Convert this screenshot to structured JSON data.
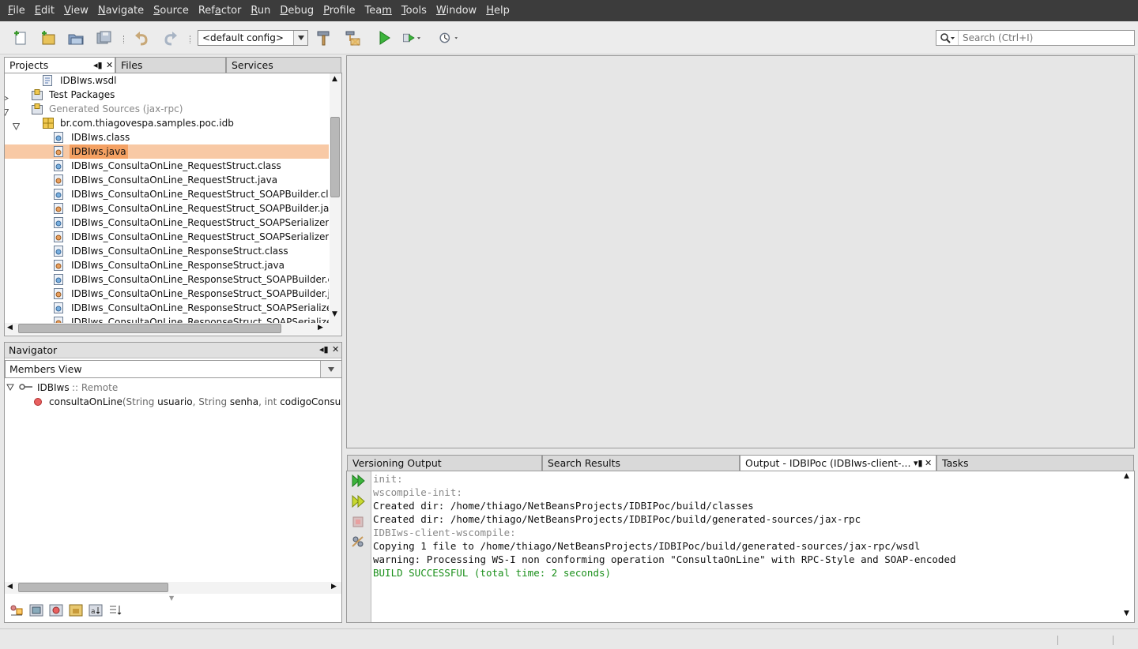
{
  "menu": {
    "items": [
      {
        "pre": "",
        "u": "F",
        "post": "ile"
      },
      {
        "pre": "",
        "u": "E",
        "post": "dit"
      },
      {
        "pre": "",
        "u": "V",
        "post": "iew"
      },
      {
        "pre": "",
        "u": "N",
        "post": "avigate"
      },
      {
        "pre": "",
        "u": "S",
        "post": "ource"
      },
      {
        "pre": "Ref",
        "u": "a",
        "post": "ctor"
      },
      {
        "pre": "",
        "u": "R",
        "post": "un"
      },
      {
        "pre": "",
        "u": "D",
        "post": "ebug"
      },
      {
        "pre": "",
        "u": "P",
        "post": "rofile"
      },
      {
        "pre": "Tea",
        "u": "m",
        "post": ""
      },
      {
        "pre": "",
        "u": "T",
        "post": "ools"
      },
      {
        "pre": "",
        "u": "W",
        "post": "indow"
      },
      {
        "pre": "",
        "u": "H",
        "post": "elp"
      }
    ]
  },
  "toolbar": {
    "config_value": "<default config>",
    "search_placeholder": "Search (Ctrl+I)",
    "icons": [
      "new-file-icon",
      "new-project-icon",
      "open-project-icon",
      "save-all-icon",
      "undo-icon",
      "redo-icon",
      "build-hammer-icon",
      "clean-build-icon",
      "run-icon",
      "debug-icon",
      "profile-icon"
    ]
  },
  "projects_panel": {
    "tabs": [
      "Projects",
      "Files",
      "Services"
    ],
    "tree": [
      {
        "label": "IDBIws.wsdl",
        "indent": 2,
        "toggle": "",
        "icon": "wsdl-file-icon",
        "grey": false,
        "selected": false
      },
      {
        "label": "Test Packages",
        "indent": 1,
        "toggle": "collapsed",
        "icon": "package-folder-icon",
        "grey": false,
        "selected": false
      },
      {
        "label": "Generated Sources (jax-rpc)",
        "indent": 1,
        "toggle": "expanded",
        "icon": "package-folder-icon",
        "grey": true,
        "selected": false
      },
      {
        "label": "br.com.thiagovespa.samples.poc.idb",
        "indent": 2,
        "toggle": "expanded",
        "icon": "package-icon",
        "grey": false,
        "selected": false
      },
      {
        "label": "IDBIws.class",
        "indent": 3,
        "toggle": "",
        "icon": "class-file-icon",
        "grey": false,
        "selected": false
      },
      {
        "label": "IDBIws.java",
        "indent": 3,
        "toggle": "",
        "icon": "java-file-icon",
        "grey": false,
        "selected": true
      },
      {
        "label": "IDBIws_ConsultaOnLine_RequestStruct.class",
        "indent": 3,
        "toggle": "",
        "icon": "class-file-icon",
        "grey": false,
        "selected": false
      },
      {
        "label": "IDBIws_ConsultaOnLine_RequestStruct.java",
        "indent": 3,
        "toggle": "",
        "icon": "java-file-icon",
        "grey": false,
        "selected": false
      },
      {
        "label": "IDBIws_ConsultaOnLine_RequestStruct_SOAPBuilder.class",
        "indent": 3,
        "toggle": "",
        "icon": "class-file-icon",
        "grey": false,
        "selected": false
      },
      {
        "label": "IDBIws_ConsultaOnLine_RequestStruct_SOAPBuilder.java",
        "indent": 3,
        "toggle": "",
        "icon": "java-file-icon",
        "grey": false,
        "selected": false
      },
      {
        "label": "IDBIws_ConsultaOnLine_RequestStruct_SOAPSerializer.class",
        "indent": 3,
        "toggle": "",
        "icon": "class-file-icon",
        "grey": false,
        "selected": false
      },
      {
        "label": "IDBIws_ConsultaOnLine_RequestStruct_SOAPSerializer.java",
        "indent": 3,
        "toggle": "",
        "icon": "java-file-icon",
        "grey": false,
        "selected": false
      },
      {
        "label": "IDBIws_ConsultaOnLine_ResponseStruct.class",
        "indent": 3,
        "toggle": "",
        "icon": "class-file-icon",
        "grey": false,
        "selected": false
      },
      {
        "label": "IDBIws_ConsultaOnLine_ResponseStruct.java",
        "indent": 3,
        "toggle": "",
        "icon": "java-file-icon",
        "grey": false,
        "selected": false
      },
      {
        "label": "IDBIws_ConsultaOnLine_ResponseStruct_SOAPBuilder.class",
        "indent": 3,
        "toggle": "",
        "icon": "class-file-icon",
        "grey": false,
        "selected": false
      },
      {
        "label": "IDBIws_ConsultaOnLine_ResponseStruct_SOAPBuilder.java",
        "indent": 3,
        "toggle": "",
        "icon": "java-file-icon",
        "grey": false,
        "selected": false
      },
      {
        "label": "IDBIws_ConsultaOnLine_ResponseStruct_SOAPSerializer.class",
        "indent": 3,
        "toggle": "",
        "icon": "class-file-icon",
        "grey": false,
        "selected": false
      },
      {
        "label": "IDBIws_ConsultaOnLine_ResponseStruct_SOAPSerializer.java",
        "indent": 3,
        "toggle": "",
        "icon": "java-file-icon",
        "grey": false,
        "selected": false
      }
    ]
  },
  "navigator": {
    "title": "Navigator",
    "view": "Members View",
    "root_name": "IDBIws",
    "root_kind": " :: Remote",
    "method_name": "consultaOnLine",
    "method_sig": [
      {
        "t": "(",
        "grey": true
      },
      {
        "t": "String",
        "grey": true
      },
      {
        "t": " usuario",
        "grey": false
      },
      {
        "t": ", ",
        "grey": true
      },
      {
        "t": "String",
        "grey": true
      },
      {
        "t": " senha",
        "grey": false
      },
      {
        "t": ", ",
        "grey": true
      },
      {
        "t": "int",
        "grey": true
      },
      {
        "t": " codigoConsulta",
        "grey": false
      }
    ]
  },
  "output_panel": {
    "tabs": [
      "Versioning Output",
      "Search Results",
      "Output - IDBIPoc (IDBIws-client-...",
      "Tasks"
    ],
    "lines": [
      {
        "text": "init:",
        "style": "grey"
      },
      {
        "text": "wscompile-init:",
        "style": "grey"
      },
      {
        "text": "Created dir: /home/thiago/NetBeansProjects/IDBIPoc/build/classes",
        "style": "normal"
      },
      {
        "text": "Created dir: /home/thiago/NetBeansProjects/IDBIPoc/build/generated-sources/jax-rpc",
        "style": "normal"
      },
      {
        "text": "IDBIws-client-wscompile:",
        "style": "grey"
      },
      {
        "text": "Copying 1 file to /home/thiago/NetBeansProjects/IDBIPoc/build/generated-sources/jax-rpc/wsdl",
        "style": "normal"
      },
      {
        "text": "warning: Processing WS-I non conforming operation \"ConsultaOnLine\" with RPC-Style and SOAP-encoded",
        "style": "normal"
      },
      {
        "text": "BUILD SUCCESSFUL (total time: 2 seconds)",
        "style": "green"
      }
    ]
  },
  "colors": {
    "menubar": "#3c3c3c",
    "selection": "#f4a163",
    "build_success": "#1a8f1a"
  }
}
